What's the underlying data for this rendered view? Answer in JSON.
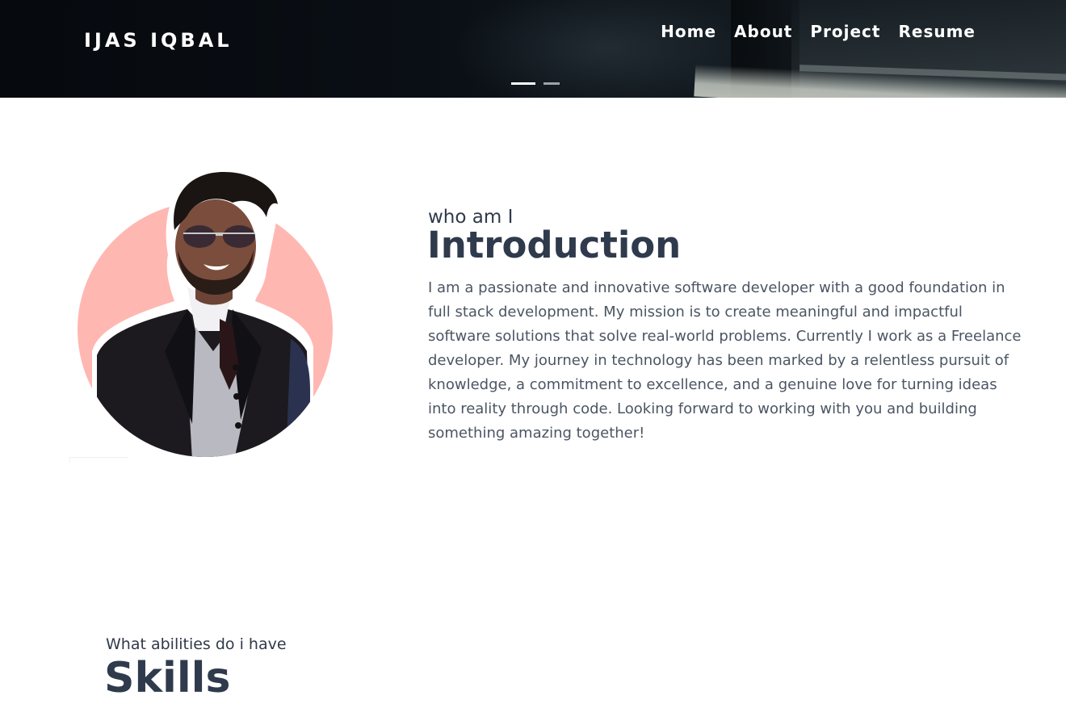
{
  "header": {
    "brand": "IJAS IQBAL",
    "nav": [
      {
        "label": "Home"
      },
      {
        "label": "About"
      },
      {
        "label": "Project"
      },
      {
        "label": "Resume"
      }
    ],
    "carousel": {
      "slides": 2,
      "active_index": 0
    }
  },
  "intro": {
    "subtitle": "who am I",
    "title": "Introduction",
    "paragraph": "I am a passionate and innovative software developer with a good foundation in full stack development. My mission is to create meaningful and impactful software solutions that solve real-world problems. Currently I work as a Freelance developer. My journey in technology has been marked by a relentless pursuit of knowledge, a commitment to excellence, and a genuine love for turning ideas into reality through code. Looking forward to working with you and building something amazing together!",
    "photo_circle_color": "#ffb7b2"
  },
  "skills": {
    "subtitle": "What abilities do i have",
    "title": "Skills"
  },
  "colors": {
    "heading": "#2f3a4c",
    "body_text": "#4b5563",
    "nav_text": "#ffffff"
  }
}
